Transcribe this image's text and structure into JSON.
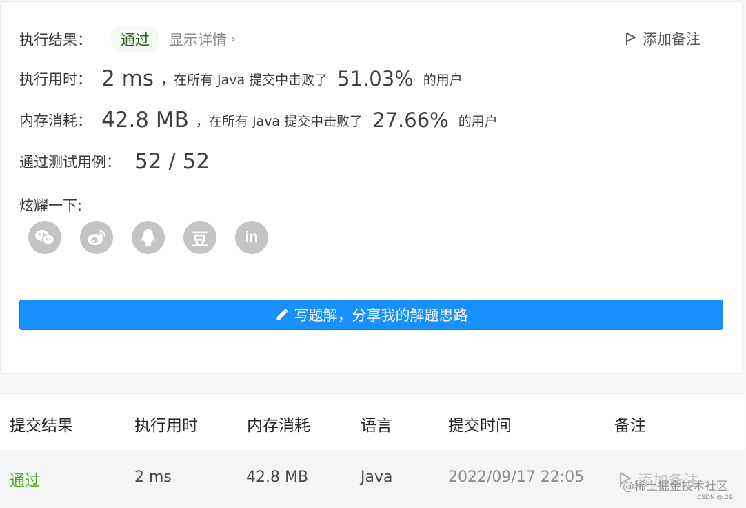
{
  "result": {
    "label": "执行结果：",
    "status": "通过",
    "detail_link": "显示详情",
    "add_note": "添加备注"
  },
  "runtime": {
    "label": "执行用时：",
    "value": "2 ms",
    "mid_text": "，在所有 Java 提交中击败了",
    "percent": "51.03%",
    "suffix": "的用户"
  },
  "memory": {
    "label": "内存消耗：",
    "value": "42.8 MB",
    "mid_text": "，在所有 Java 提交中击败了",
    "percent": "27.66%",
    "suffix": "的用户"
  },
  "testcases": {
    "label": "通过测试用例：",
    "value": "52 / 52"
  },
  "share": {
    "label": "炫耀一下:",
    "icons": [
      "wechat-icon",
      "weibo-icon",
      "qq-icon",
      "douban-icon",
      "linkedin-icon"
    ],
    "douban_glyph": "豆",
    "linkedin_glyph": "in"
  },
  "write_button": {
    "label": "写题解，分享我的解题思路"
  },
  "table": {
    "headers": [
      "提交结果",
      "执行用时",
      "内存消耗",
      "语言",
      "提交时间",
      "备注"
    ],
    "rows": [
      {
        "result": "通过",
        "runtime": "2 ms",
        "memory": "42.8 MB",
        "language": "Java",
        "time": "2022/09/17 22:05",
        "note": "添加备注"
      }
    ]
  },
  "watermark": {
    "line1": "@稀土掘金技术社区",
    "line2": "CSDN @.29."
  },
  "colors": {
    "primary": "#1890ff",
    "pass_green": "#4fa81e",
    "icon_gray": "#c4c4c4"
  }
}
